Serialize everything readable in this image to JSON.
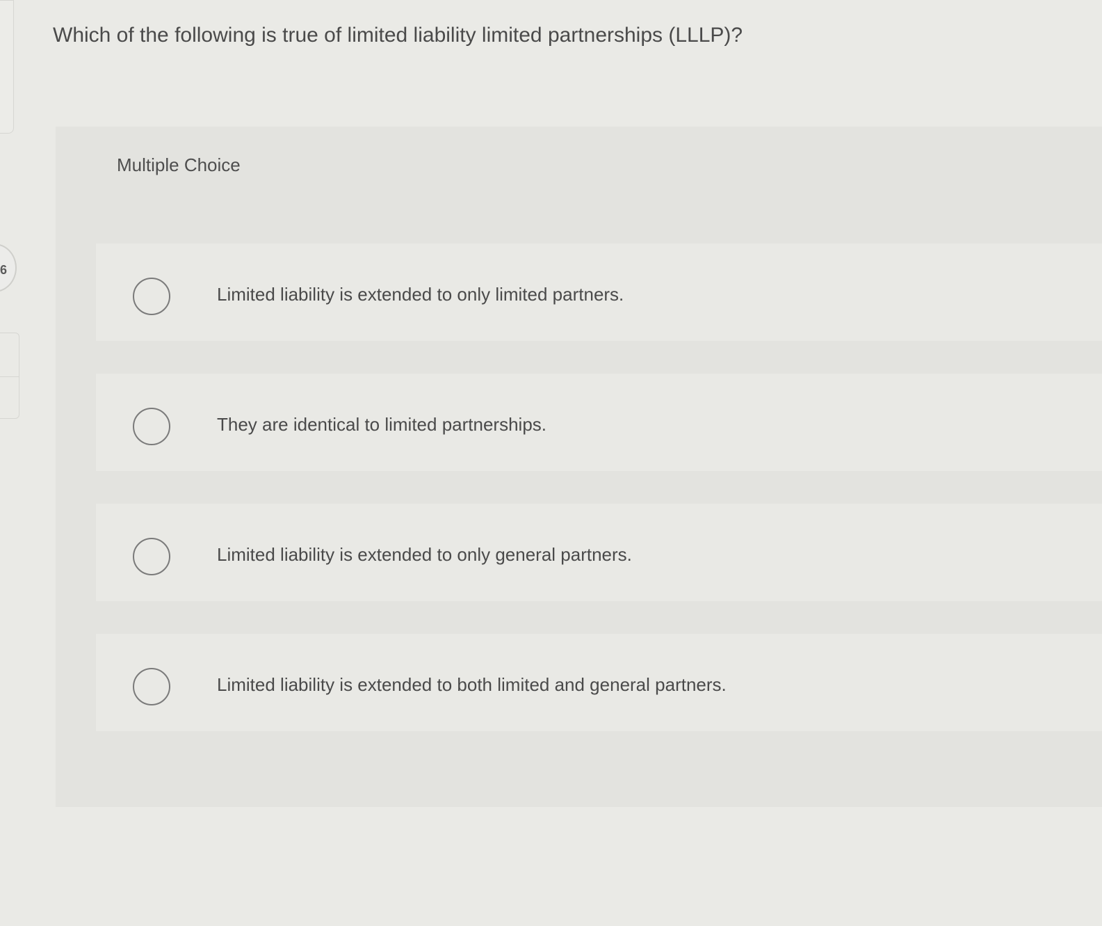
{
  "sidebar": {
    "question_number": "6"
  },
  "question": {
    "text": "Which of the following is true of limited liability limited partnerships (LLLP)?"
  },
  "answer_section": {
    "type_label": "Multiple Choice",
    "options": [
      {
        "label": "Limited liability is extended to only limited partners.",
        "selected": false
      },
      {
        "label": "They are identical to limited partnerships.",
        "selected": false
      },
      {
        "label": "Limited liability is extended to only general partners.",
        "selected": false
      },
      {
        "label": "Limited liability is extended to both limited and general partners.",
        "selected": false
      }
    ]
  },
  "colors": {
    "page_background": "#eaeae6",
    "panel_background": "#e3e3df",
    "option_background": "#e9e9e5",
    "text": "#4a4a4a",
    "radio_border": "#7a7a7a"
  }
}
